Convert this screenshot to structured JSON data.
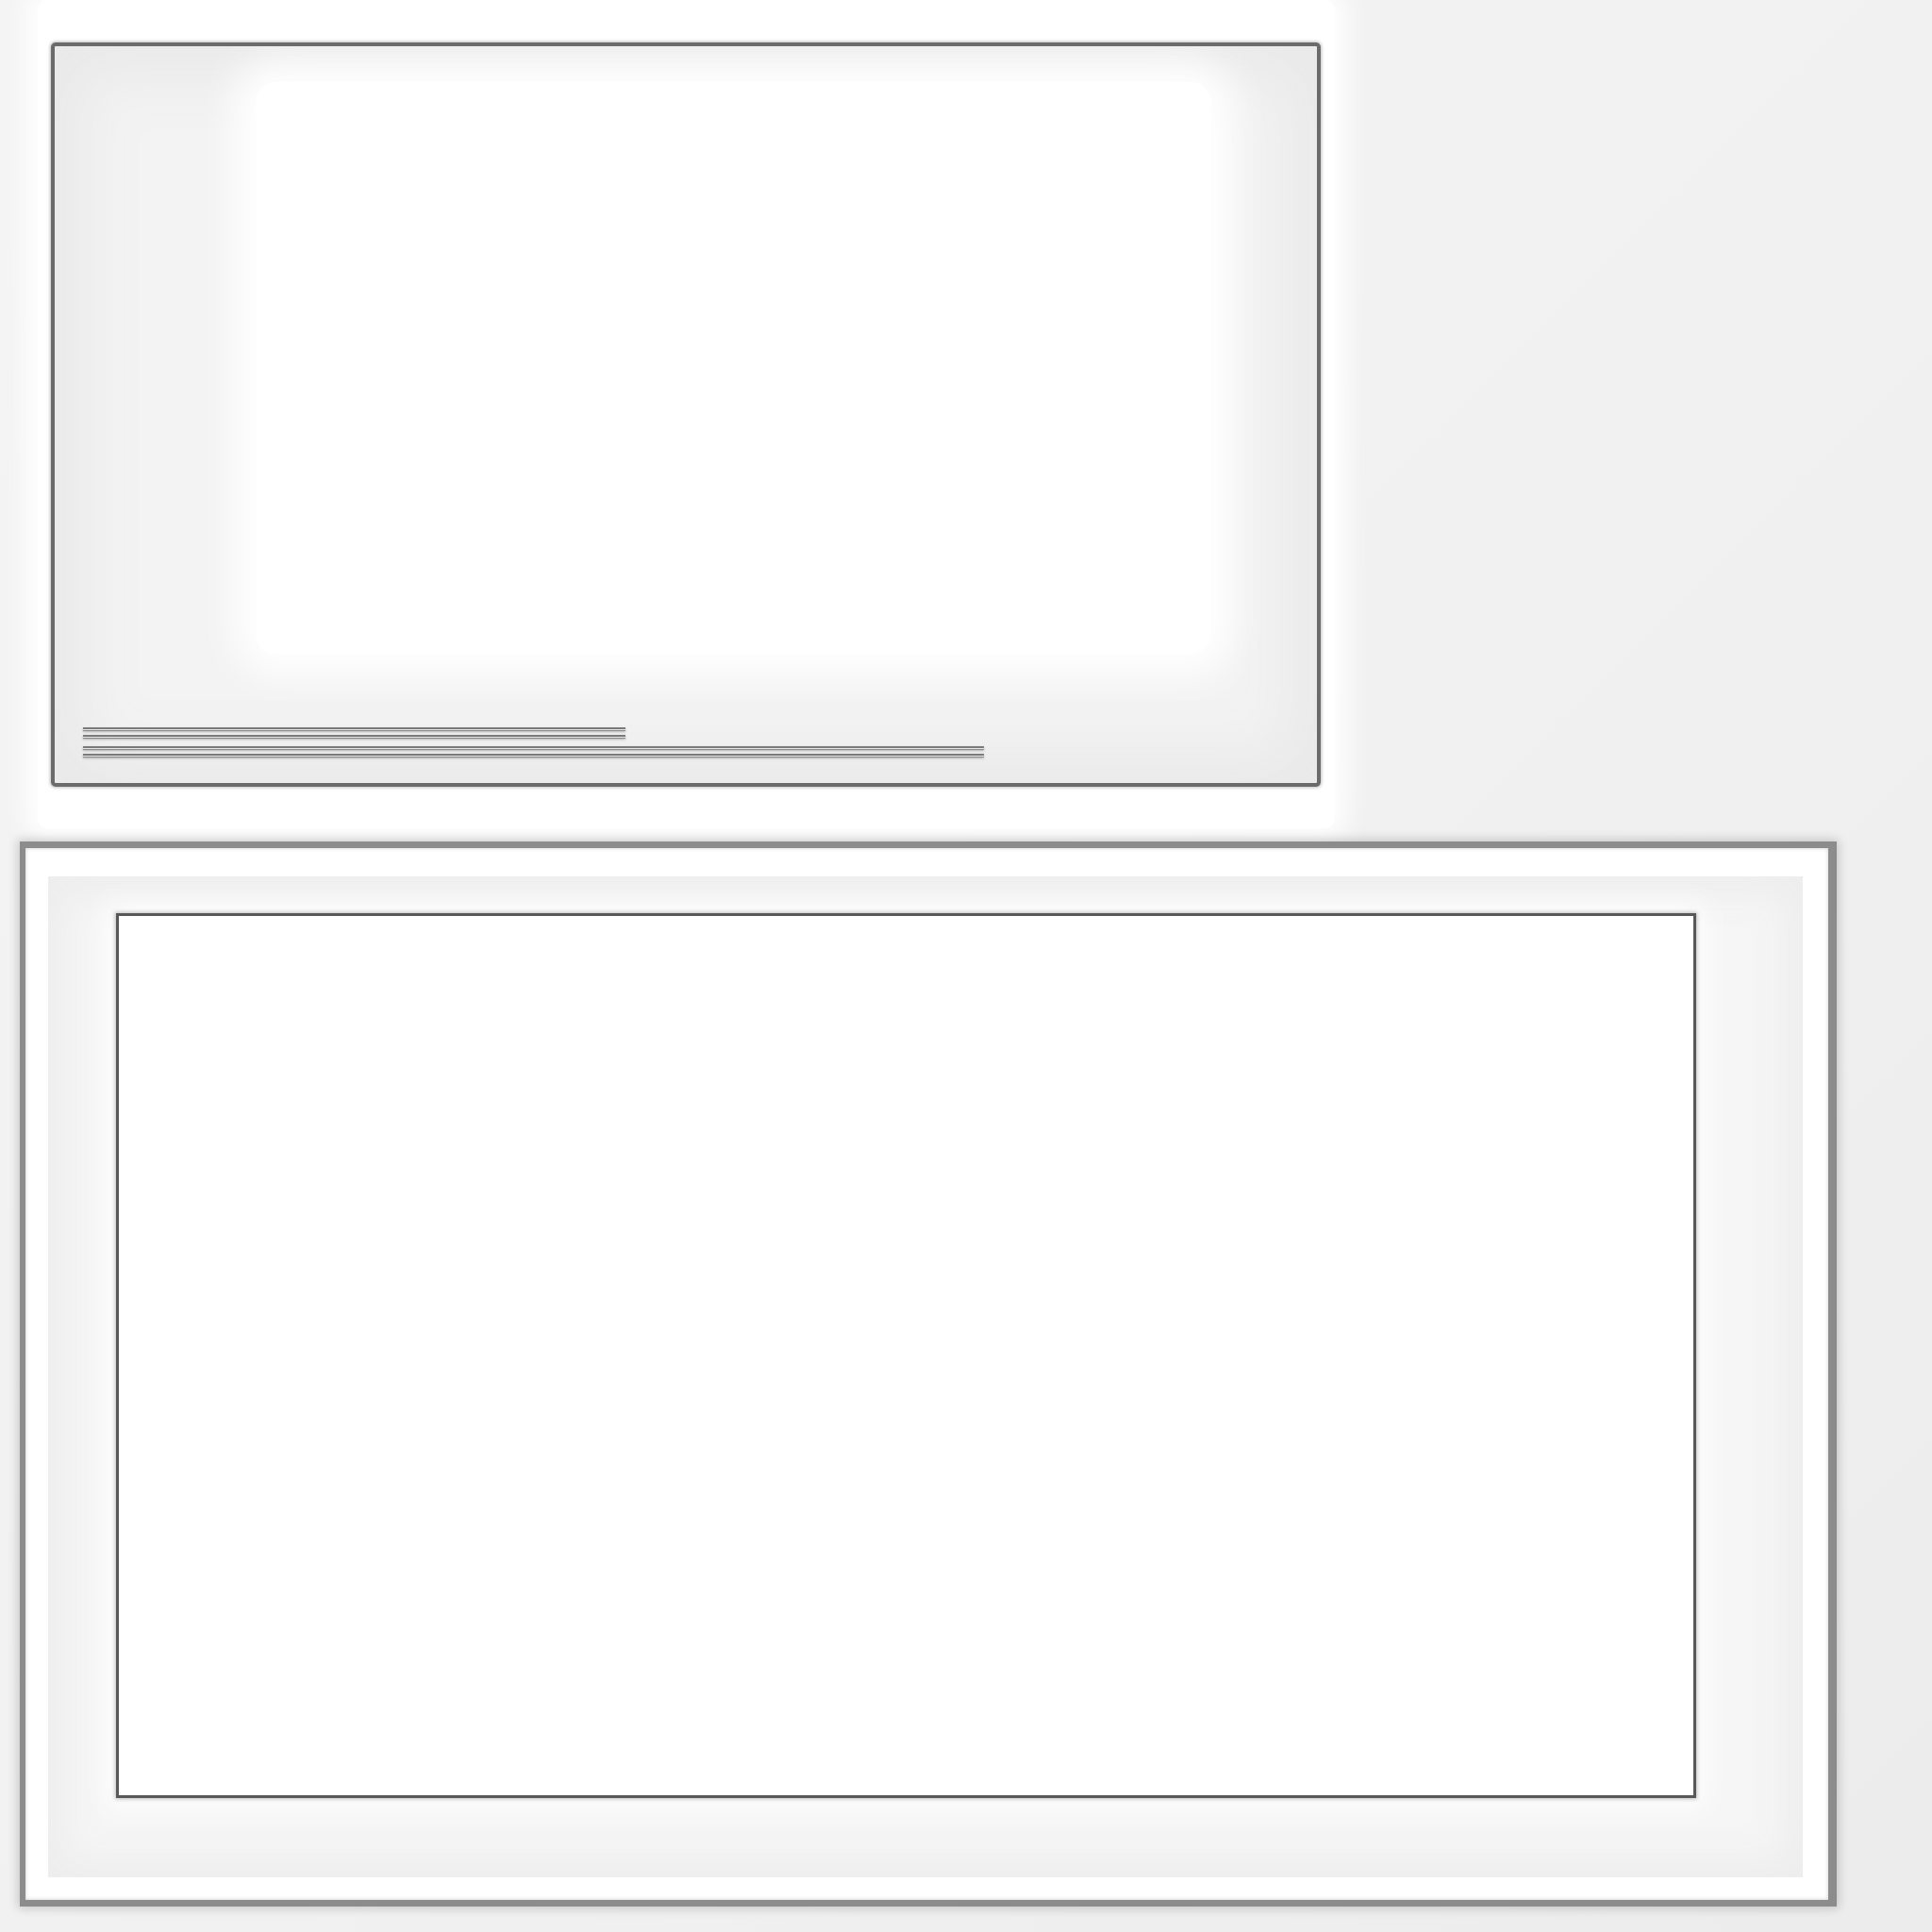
{
  "top_panel": {
    "progress_primary": 0.6,
    "progress_secondary": 1.0
  },
  "bottom_panel": {},
  "colors": {
    "background": "#f1f1f1",
    "panel_border": "#6b6b6b",
    "frame_border": "#8c8c8c",
    "inner_border": "#585858",
    "track_fill": "#7a7a7a"
  }
}
